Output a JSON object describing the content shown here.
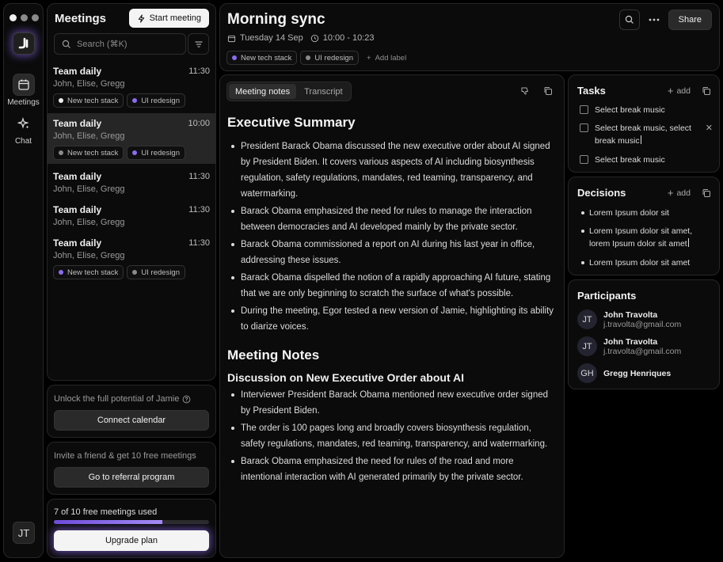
{
  "rail": {
    "logo": "J",
    "items": [
      {
        "label": "Meetings",
        "icon": "calendar-icon"
      },
      {
        "label": "Chat",
        "icon": "sparkle-icon"
      }
    ],
    "avatar": "JT"
  },
  "meetings_panel": {
    "title": "Meetings",
    "start_button": "Start meeting",
    "search_placeholder": "Search (⌘K)",
    "items": [
      {
        "title": "Team daily",
        "time": "11:30",
        "people": "John, Elise, Gregg",
        "tags": [
          "New tech stack",
          "UI redesign"
        ]
      },
      {
        "title": "Team daily",
        "time": "10:00",
        "people": "John, Elise, Gregg",
        "tags": [
          "New tech stack",
          "UI redesign"
        ]
      },
      {
        "title": "Team daily",
        "time": "11:30",
        "people": "John, Elise, Gregg",
        "tags": []
      },
      {
        "title": "Team daily",
        "time": "11:30",
        "people": "John, Elise, Gregg",
        "tags": []
      },
      {
        "title": "Team daily",
        "time": "11:30",
        "people": "John, Elise, Gregg",
        "tags": [
          "New tech stack",
          "UI redesign"
        ]
      }
    ]
  },
  "promo": {
    "unlock_text": "Unlock the full potential of Jamie",
    "connect_button": "Connect calendar",
    "invite_text": "Invite a friend & get 10 free meetings",
    "referral_button": "Go to referral program",
    "usage_text": "7 of 10 free meetings used",
    "usage_fraction": 0.7,
    "upgrade_button": "Upgrade plan"
  },
  "header": {
    "title": "Morning sync",
    "date": "Tuesday 14 Sep",
    "time": "10:00 - 10:23",
    "tags": [
      "New tech stack",
      "UI redesign"
    ],
    "add_label": "Add label",
    "share_button": "Share"
  },
  "notes": {
    "tabs": [
      "Meeting notes",
      "Transcript"
    ],
    "summary_heading": "Executive Summary",
    "summary_items": [
      "President Barack Obama discussed the new executive order about AI signed by President Biden. It covers various aspects of AI including biosynthesis regulation, safety regulations, mandates, red teaming, transparency, and watermarking.",
      "Barack Obama emphasized the need for rules to manage the interaction between democracies and AI developed mainly by the private sector.",
      "Barack Obama commissioned a report on AI during his last year in office, addressing these issues.",
      "Barack Obama dispelled the notion of a rapidly approaching AI future, stating that we are only beginning to scratch the surface of what's possible.",
      "During the meeting, Egor tested a new version of Jamie, highlighting its ability to diarize voices."
    ],
    "notes_heading": "Meeting Notes",
    "sub_heading": "Discussion on New Executive Order about AI",
    "notes_items": [
      "Interviewer President Barack Obama mentioned new executive order signed by President Biden.",
      "The order is 100 pages long and broadly covers biosynthesis regulation, safety regulations, mandates, red teaming, transparency, and watermarking.",
      "Barack Obama emphasized the need for rules of the road and more intentional interaction with AI generated primarily by the private sector."
    ]
  },
  "tasks": {
    "title": "Tasks",
    "add": "add",
    "items": [
      "Select break music",
      "Select break music, select break music",
      "Select break music"
    ]
  },
  "decisions": {
    "title": "Decisions",
    "add": "add",
    "items": [
      "Lorem Ipsum dolor sit",
      "Lorem Ipsum dolor sit amet, lorem Ipsum dolor sit amet",
      "Lorem Ipsum dolor sit amet"
    ]
  },
  "participants": {
    "title": "Participants",
    "people": [
      {
        "initials": "JT",
        "name": "John Travolta",
        "email": "j.travolta@gmail.com"
      },
      {
        "initials": "JT",
        "name": "John Travolta",
        "email": "j.travolta@gmail.com"
      },
      {
        "initials": "GH",
        "name": "Gregg Henriques",
        "email": ""
      }
    ]
  },
  "colors": {
    "tag_white": "#f0f0f0",
    "tag_purple": "#8b6cf0",
    "tag_gray": "#8a8a8a",
    "accent_glow": "#966eff"
  }
}
